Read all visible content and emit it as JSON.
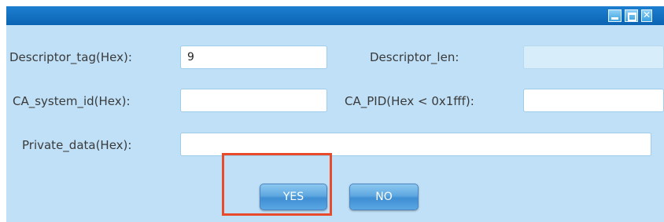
{
  "window": {
    "controls": {
      "minimize": "minimize-icon",
      "maximize": "maximize-icon",
      "close": "close-icon"
    }
  },
  "form": {
    "descriptor_tag": {
      "label": "Descriptor_tag(Hex):",
      "value": "9"
    },
    "descriptor_len": {
      "label": "Descriptor_len:",
      "value": ""
    },
    "ca_system_id": {
      "label": "CA_system_id(Hex):",
      "value": ""
    },
    "ca_pid": {
      "label": "CA_PID(Hex < 0x1fff):",
      "value": ""
    },
    "private_data": {
      "label": "Private_data(Hex):",
      "value": ""
    }
  },
  "buttons": {
    "yes": "YES",
    "no": "NO"
  },
  "colors": {
    "titlebar": "#0b63b3",
    "dialog_background": "#bfe0f7",
    "highlight": "#e84a2c"
  }
}
